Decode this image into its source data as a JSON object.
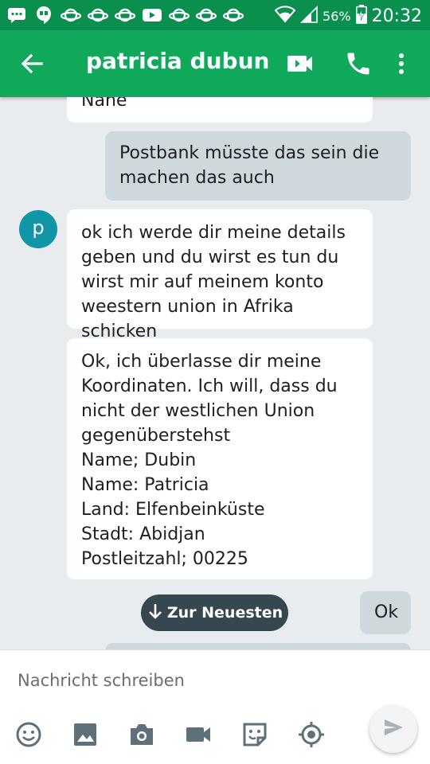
{
  "status_bar": {
    "battery_percent": "56%",
    "time": "20:32"
  },
  "app_bar": {
    "title": "patricia dubun"
  },
  "conversation": {
    "contact_initial": "p",
    "messages": [
      {
        "direction": "in",
        "text": "Nane"
      },
      {
        "direction": "out",
        "text": "Postbank müsste das sein die\nmachen das auch"
      },
      {
        "direction": "in",
        "text": "ok ich werde dir meine details\ngeben und du wirst es tun du\nwirst mir auf meinem konto\nweestern union in Afrika schicken"
      },
      {
        "direction": "in",
        "text": "Ok, ich überlasse dir meine\nKoordinaten. Ich will, dass du\nnicht der westlichen Union\ngegenüberstehst\nName; Dubin\nName: Patricia\nLand: Elfenbeinküste\nStadt: Abidjan\nPostleitzahl; 00225"
      },
      {
        "direction": "out",
        "text": "Ok"
      }
    ],
    "jump_label": "Zur Neuesten"
  },
  "composer": {
    "placeholder": "Nachricht schreiben"
  },
  "colors": {
    "status_bar": "#0b8f4f",
    "app_bar": "#10a85a",
    "outgoing_bubble": "#cfd8dc",
    "avatar": "#1196a8",
    "icon_gray": "#5f7178"
  }
}
